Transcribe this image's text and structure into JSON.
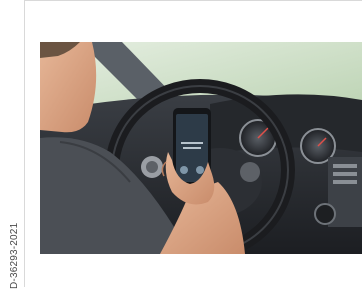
{
  "document": {
    "figure_code": "D-36293-2021"
  },
  "photo": {
    "subject": "driver-holding-phone-in-car",
    "colors": {
      "window": "#cfe0c6",
      "dashboard": "#2b2e33",
      "phone_screen": "#2d3b48",
      "skin": "#d9a584",
      "shirt": "#4b4f55"
    }
  }
}
